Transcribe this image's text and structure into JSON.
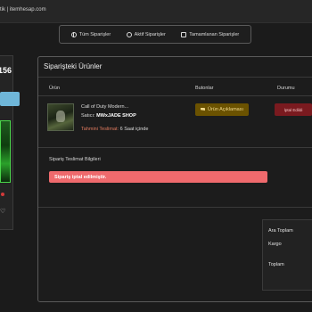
{
  "topbar": {
    "brand": "tik | itemhesap.com"
  },
  "tabs": [
    {
      "label": "Tüm Siparişler",
      "icon": "globe-icon"
    },
    {
      "label": "Aktif Siparişler",
      "icon": "clock-icon"
    },
    {
      "label": "Tamamlanan Siparişler",
      "icon": "check-square-icon"
    }
  ],
  "left_card": {
    "number": "156"
  },
  "order": {
    "title": "Siparişteki Ürünler",
    "columns": {
      "product": "Ürün",
      "buttons": "Butonlar",
      "status": "Durumu"
    },
    "product": {
      "name": "Call of Duty Modern...",
      "seller_label": "Satıcı:",
      "seller": "MWxJADE SHOP",
      "delivery_label": "Tahmini Teslimat:",
      "delivery_value": "6 Saat içinde"
    },
    "description_button": "Ürün Açıklaması",
    "status": "İptal Edildi"
  },
  "shipping": {
    "title": "Sipariş Teslimat Bilgileri",
    "alert": "Sipariş iptal edilmiştir."
  },
  "summary": {
    "subtotal": "Ara Toplam",
    "shipping": "Kargo",
    "total": "Toplam"
  },
  "colors": {
    "background": "#1b1b1b",
    "alert": "#ef6a6d",
    "status_cancelled": "#7a1a1f",
    "accent_gold": "#6b5200",
    "accent_blue": "#6fb6d8"
  }
}
